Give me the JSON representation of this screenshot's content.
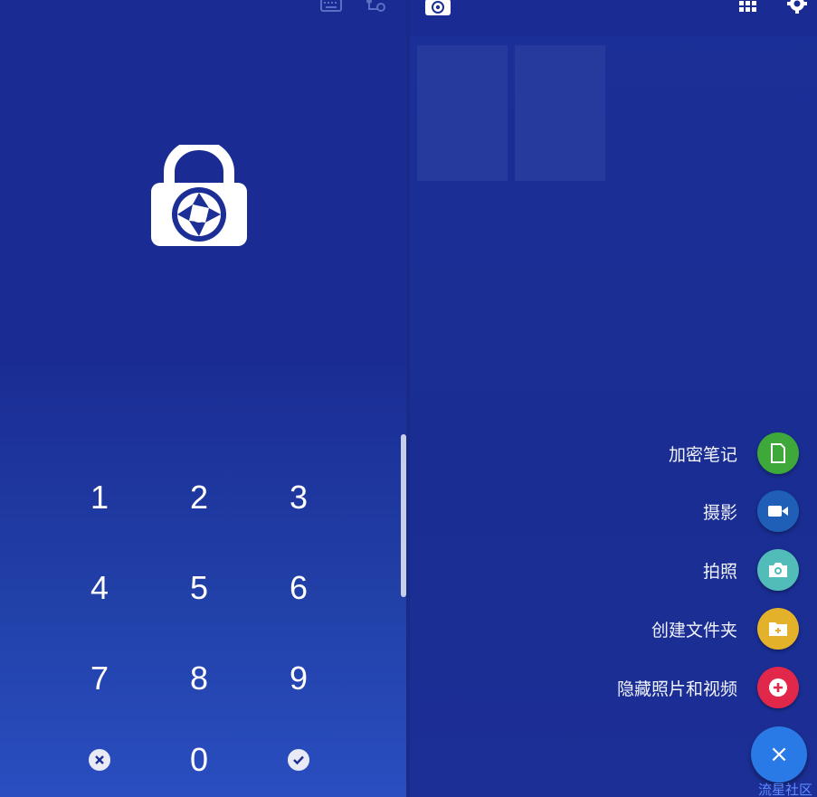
{
  "lock_screen": {
    "keys": [
      "1",
      "2",
      "3",
      "4",
      "5",
      "6",
      "7",
      "8",
      "9",
      "clear",
      "0",
      "confirm"
    ],
    "key_labels": {
      "k1": "1",
      "k2": "2",
      "k3": "3",
      "k4": "4",
      "k5": "5",
      "k6": "6",
      "k7": "7",
      "k8": "8",
      "k9": "9",
      "k0": "0"
    },
    "icons": {
      "keyboard": "keyboard-icon",
      "pattern": "pattern-icon",
      "logo": "lock-camera-logo",
      "clear": "clear-x-icon",
      "confirm": "check-icon"
    }
  },
  "vault": {
    "header_icons": [
      "app-logo-icon",
      "grid-icon",
      "gear-icon"
    ],
    "menu": [
      {
        "label": "加密笔记",
        "icon": "note-icon",
        "color": "#3ea83a"
      },
      {
        "label": "摄影",
        "icon": "video-icon",
        "color": "#1f5fb8"
      },
      {
        "label": "拍照",
        "icon": "camera-icon",
        "color": "#52bdb8"
      },
      {
        "label": "创建文件夹",
        "icon": "folder-add-icon",
        "color": "#e3b12a"
      },
      {
        "label": "隐藏照片和视频",
        "icon": "plus-icon",
        "color": "#e2284a"
      }
    ],
    "fab_main_symbol": "×",
    "watermark": "流星社区"
  }
}
